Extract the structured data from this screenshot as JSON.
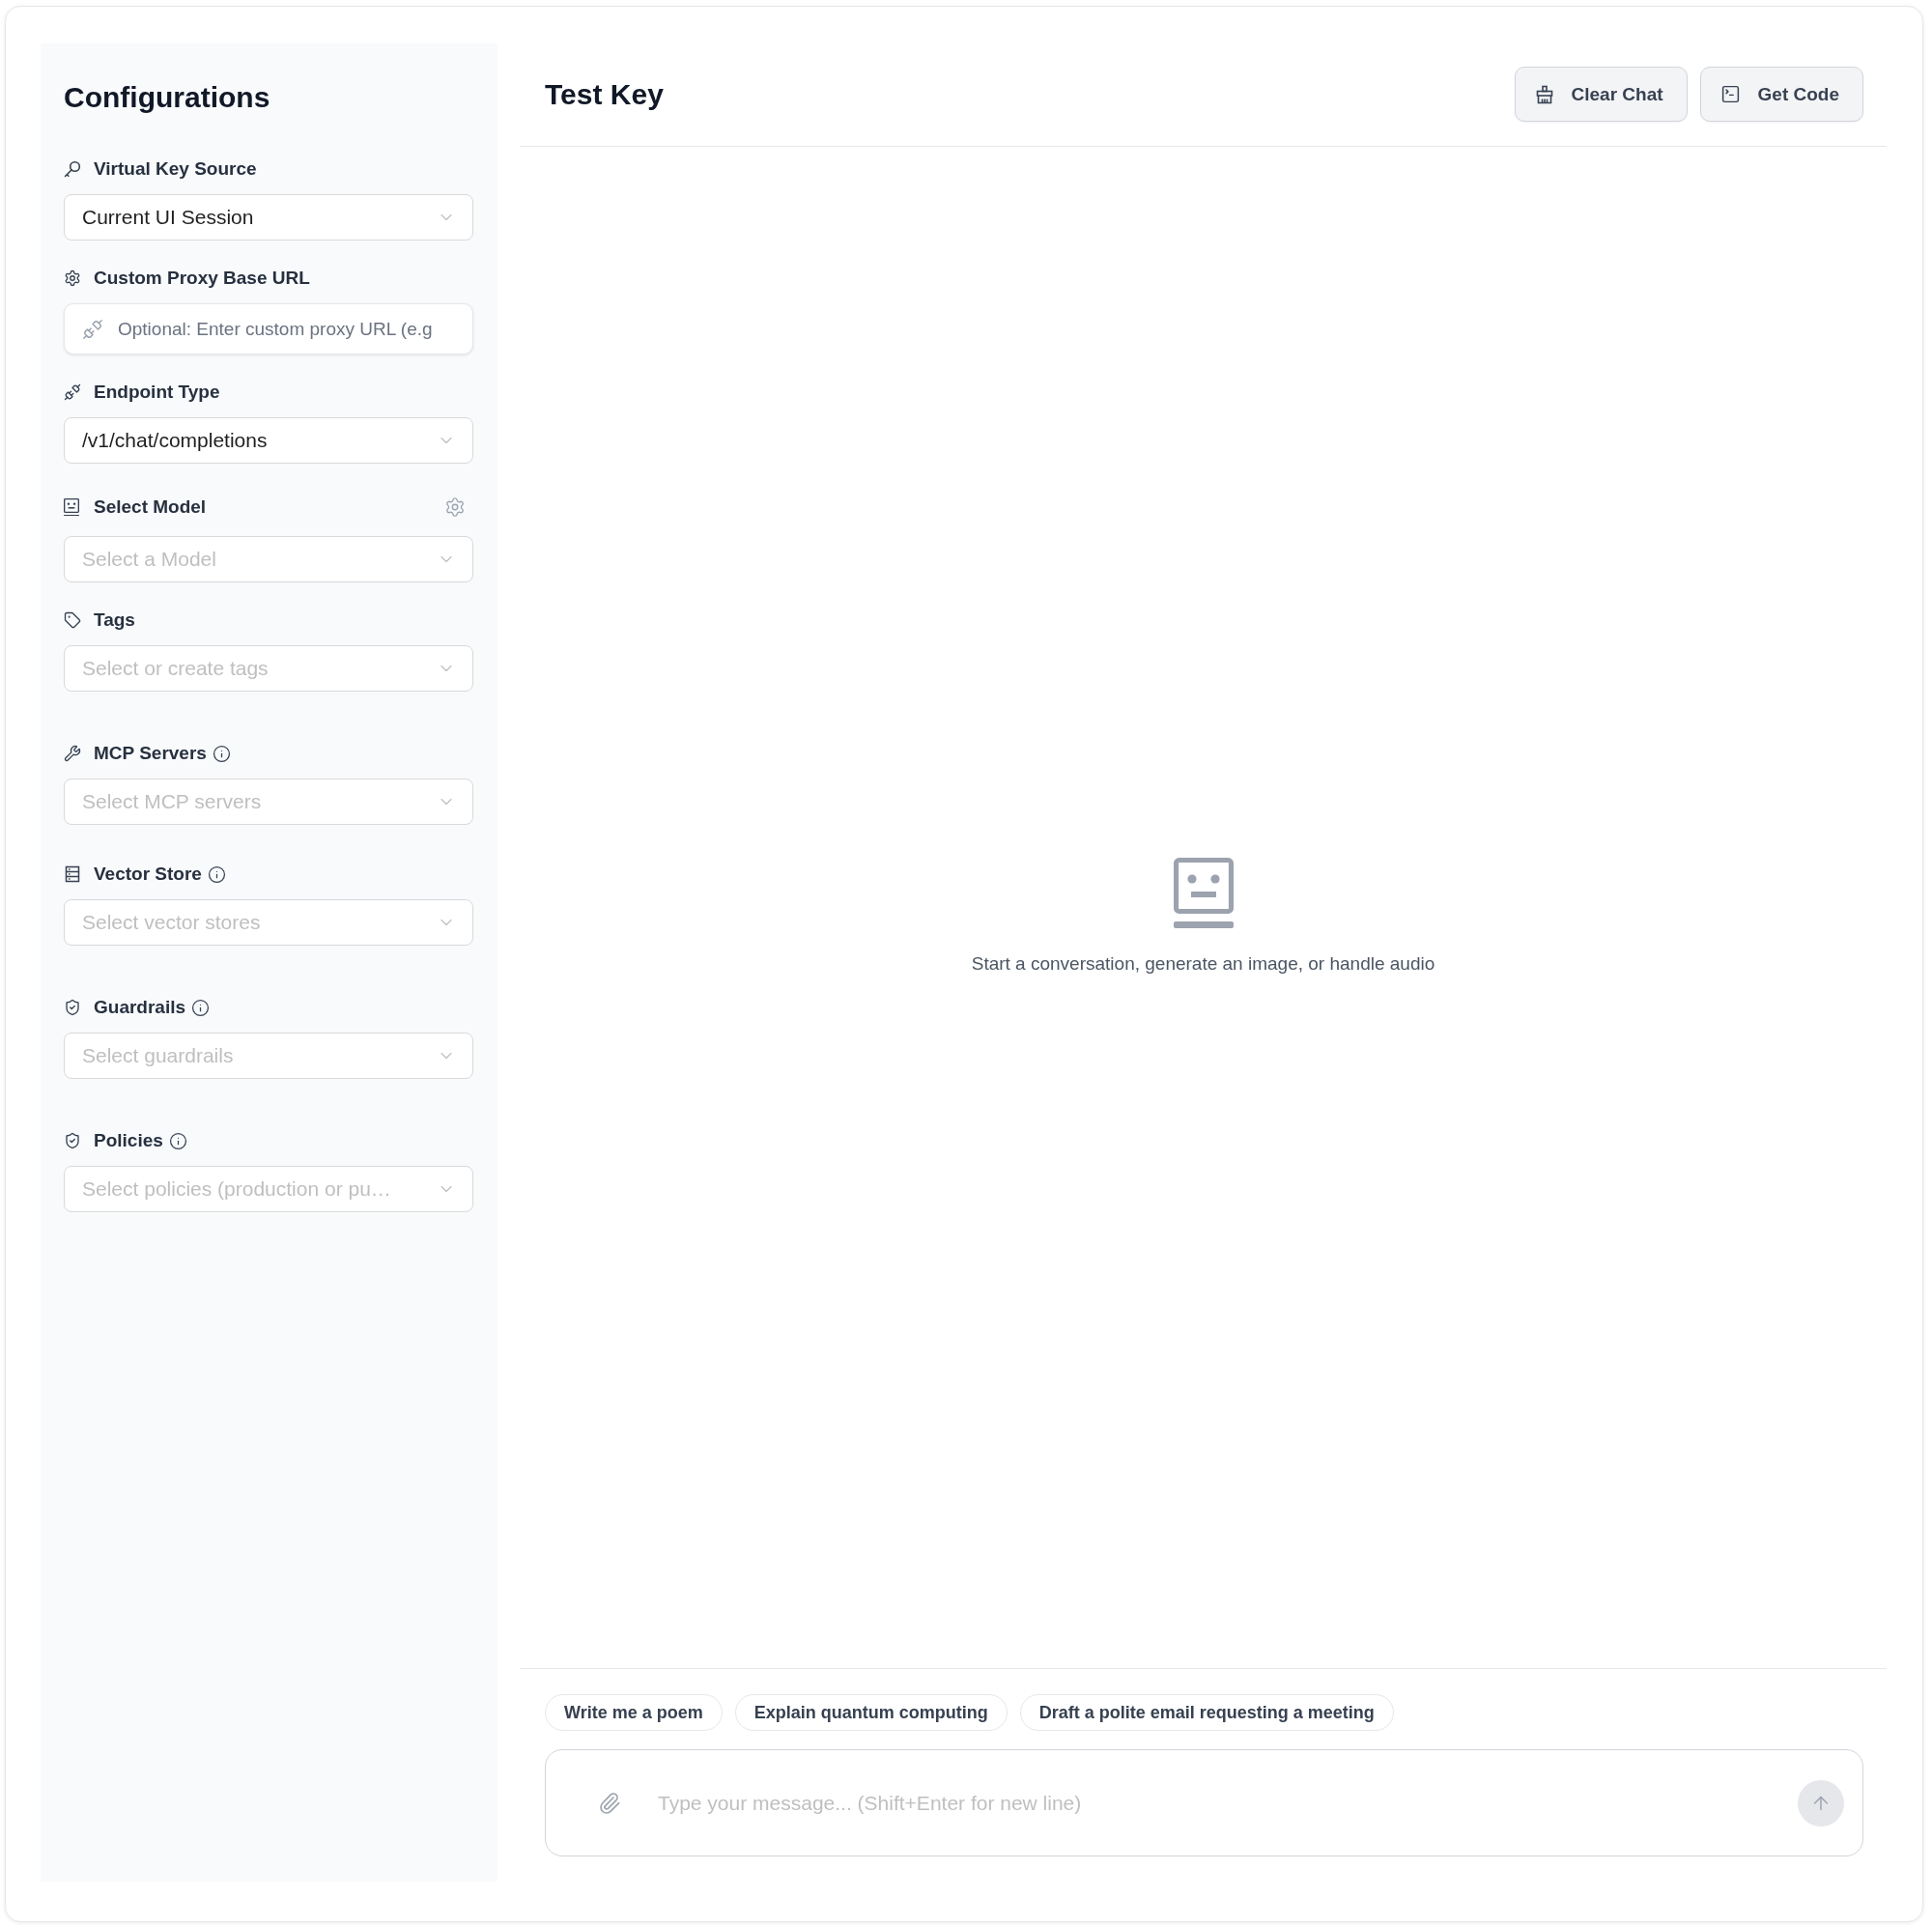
{
  "sidebar": {
    "title": "Configurations",
    "fields": [
      {
        "kind": "select",
        "label": "Virtual Key Source",
        "value": "Current UI Session"
      },
      {
        "kind": "input",
        "label": "Custom Proxy Base URL",
        "placeholder": "Optional: Enter custom proxy URL (e.g"
      },
      {
        "kind": "select",
        "label": "Endpoint Type",
        "value": "/v1/chat/completions"
      },
      {
        "kind": "select",
        "label": "Select Model",
        "placeholder": "Select a Model"
      },
      {
        "kind": "select",
        "label": "Tags",
        "placeholder": "Select or create tags"
      },
      {
        "kind": "select",
        "label": "MCP Servers",
        "placeholder": "Select MCP servers"
      },
      {
        "kind": "select",
        "label": "Vector Store",
        "placeholder": "Select vector stores"
      },
      {
        "kind": "select",
        "label": "Guardrails",
        "placeholder": "Select guardrails"
      },
      {
        "kind": "select",
        "label": "Policies",
        "placeholder": "Select policies (production or pu…"
      }
    ]
  },
  "chat": {
    "title": "Test Key",
    "buttons": [
      {
        "label": "Clear Chat"
      },
      {
        "label": "Get Code"
      }
    ],
    "empty_state": {
      "text": "Start a conversation, generate an image, or handle audio"
    },
    "suggestions": [
      "Write me a poem",
      "Explain quantum computing",
      "Draft a polite email requesting a meeting"
    ],
    "composer": {
      "placeholder": "Type your message... (Shift+Enter for new line)",
      "send_button": {
        "disabled": true
      }
    }
  }
}
